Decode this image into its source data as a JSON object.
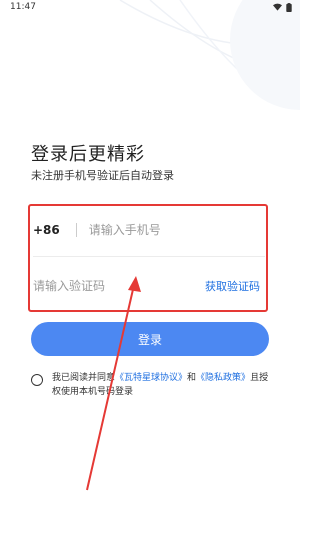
{
  "status_bar": {
    "time": "11:47"
  },
  "header": {
    "title": "登录后更精彩",
    "subtitle": "未注册手机号验证后自动登录"
  },
  "form": {
    "country_code": "+86",
    "phone_placeholder": "请输入手机号",
    "code_placeholder": "请输入验证码",
    "get_code_label": "获取验证码"
  },
  "login_button": {
    "label": "登录"
  },
  "agreement": {
    "prefix": "我已阅读并同意",
    "link1": "《瓦特星球协议》",
    "middle": "和",
    "link2": "《隐私政策》",
    "suffix": "且授权使用本机号码登录"
  },
  "colors": {
    "accent": "#4c88f2",
    "link": "#1e6fe0",
    "highlight": "#e53935"
  }
}
